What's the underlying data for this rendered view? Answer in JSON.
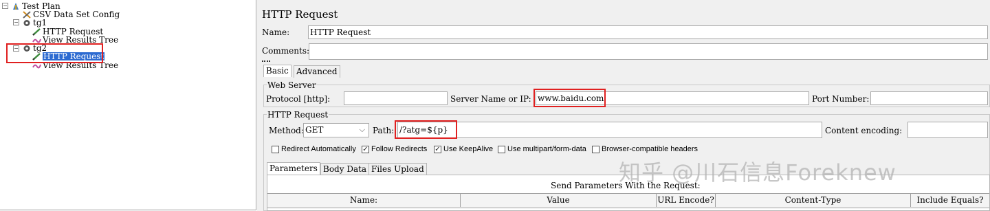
{
  "tree": {
    "items": [
      {
        "label": "Test Plan",
        "icon": "test-plan-icon"
      },
      {
        "label": "CSV Data Set Config",
        "icon": "csv-config-icon"
      },
      {
        "label": "tg1",
        "icon": "thread-group-gear-icon"
      },
      {
        "label": "HTTP Request",
        "icon": "http-sampler-pen-icon"
      },
      {
        "label": "View Results Tree",
        "icon": "listener-icon"
      },
      {
        "label": "tg2",
        "icon": "thread-group-gear-icon"
      },
      {
        "label": "HTTP Request",
        "icon": "http-sampler-pen-icon",
        "selected": true
      },
      {
        "label": "View Results Tree",
        "icon": "listener-icon"
      }
    ]
  },
  "panel": {
    "title": "HTTP Request",
    "name_label": "Name:",
    "name_value": "HTTP Request",
    "comments_label": "Comments:",
    "comments_value": "",
    "tabs": [
      "Basic",
      "Advanced"
    ],
    "web_server": {
      "legend": "Web Server",
      "protocol_label": "Protocol [http]:",
      "protocol_value": "",
      "server_label": "Server Name or IP:",
      "server_value": "www.baidu.com",
      "port_label": "Port Number:",
      "port_value": ""
    },
    "http_request": {
      "legend": "HTTP Request",
      "method_label": "Method:",
      "method_value": "GET",
      "path_label": "Path:",
      "path_value": "/?atg=${p}",
      "encoding_label": "Content encoding:",
      "encoding_value": ""
    },
    "checkboxes": [
      {
        "label": "Redirect Automatically",
        "checked": false
      },
      {
        "label": "Follow Redirects",
        "checked": true
      },
      {
        "label": "Use KeepAlive",
        "checked": true
      },
      {
        "label": "Use multipart/form-data",
        "checked": false
      },
      {
        "label": "Browser-compatible headers",
        "checked": false
      }
    ],
    "sub_tabs": [
      "Parameters",
      "Body Data",
      "Files Upload"
    ],
    "params_caption": "Send Parameters With the Request:",
    "columns": [
      "Name:",
      "Value",
      "URL Encode?",
      "Content-Type",
      "Include Equals?"
    ]
  },
  "watermark": "知乎 @川石信息Foreknew"
}
